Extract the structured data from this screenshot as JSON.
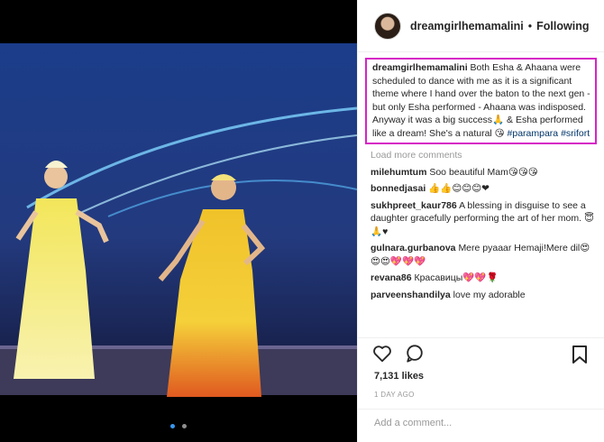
{
  "post": {
    "username": "dreamgirlhemamalini",
    "verified_glyph": "•",
    "follow_label": "Following",
    "caption": {
      "author": "dreamgirlhemamalini",
      "text": "Both Esha & Ahaana were scheduled to dance with me as it is a significant theme where I hand over the baton to the next gen - but only Esha performed - Ahaana was indisposed. Anyway it was a big success🙏 & Esha performed like a dream! She's a natural 😘",
      "hashtags": "#parampara #srifort"
    },
    "load_more": "Load more comments",
    "comments": [
      {
        "user": "milehumtum",
        "text": "Soo beautiful Mam😘😘😘"
      },
      {
        "user": "bonnedjasai",
        "text": "👍👍😊😊😊❤"
      },
      {
        "user": "sukhpreet_kaur786",
        "text": "A blessing in disguise to see a daughter gracefully performing the art of her mom. 😇🙏♥"
      },
      {
        "user": "gulnara.gurbanova",
        "text": "Mere pyaaar Hemaji!Mere dil😍😍😍💖💖💖"
      },
      {
        "user": "revana86",
        "text": "Красавицы💖💖🌹"
      },
      {
        "user": "parveenshandilya",
        "text": "love my adorable"
      }
    ],
    "likes": "7,131 likes",
    "date": "1 DAY AGO",
    "add_comment_placeholder": "Add a comment..."
  },
  "icons": {
    "like": "heart-icon",
    "comment": "comment-bubble-icon",
    "save": "bookmark-icon"
  }
}
